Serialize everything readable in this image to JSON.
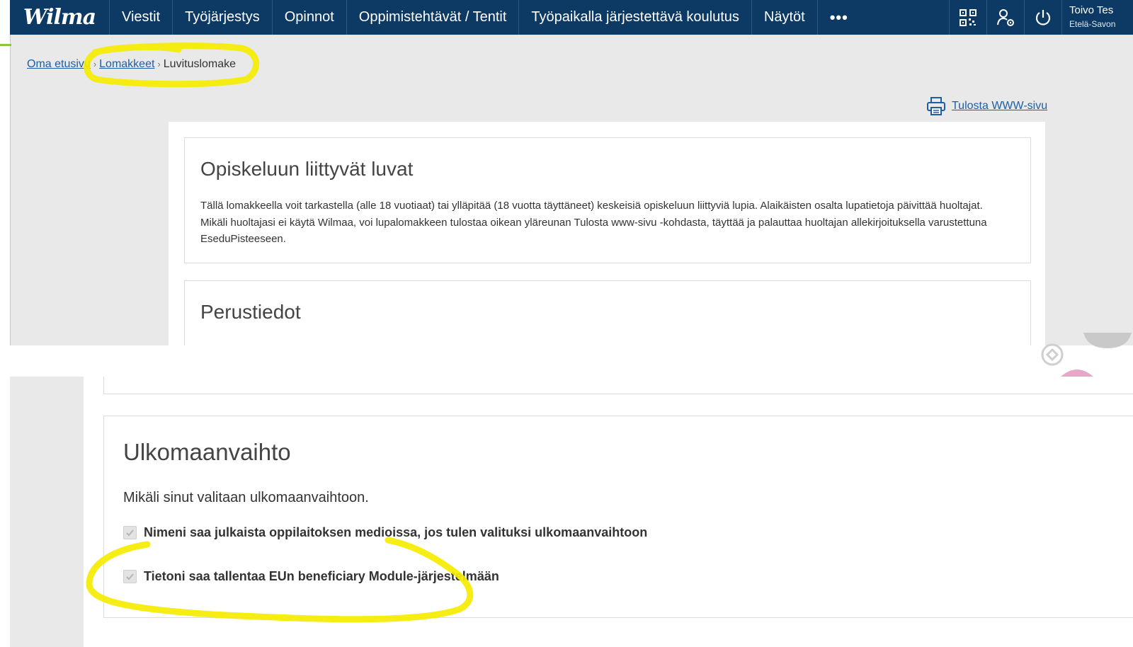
{
  "app": {
    "logo": "Wilma",
    "nav": [
      "Viestit",
      "Työjärjestys",
      "Opinnot",
      "Oppimistehtävät / Tentit",
      "Työpaikalla järjestettävä koulutus",
      "Näytöt"
    ],
    "more": "•••",
    "user": {
      "name": "Toivo Tes",
      "org": "Etelä-Savon"
    }
  },
  "breadcrumb": {
    "home": "Oma etusivu",
    "forms": "Lomakkeet",
    "current": "Luvituslomake"
  },
  "print": {
    "label": "Tulosta WWW-sivu",
    "icon": "printer-icon"
  },
  "intro": {
    "title": "Opiskeluun liittyvät luvat",
    "text": "Tällä lomakkeella voit tarkastella (alle 18 vuotiaat) tai ylläpitää (18 vuotta täyttäneet) keskeisiä opiskeluun liittyviä lupia. Alaikäisten osalta lupatietoja päivittää huoltajat. Mikäli huoltajasi ei käytä Wilmaa, voi lupalomakkeen tulostaa oikean yläreunan Tulosta www-sivu -kohdasta, täyttää ja palauttaa huoltajan allekirjoituksella varustettuna EseduPisteeseen."
  },
  "basic": {
    "title": "Perustiedot"
  },
  "exchange": {
    "title": "Ulkomaanvaihto",
    "description": "Mikäli sinut valitaan ulkomaanvaihtoon.",
    "options": [
      {
        "label": "Nimeni saa julkaista oppilaitoksen medioissa, jos tulen valituksi ulkomaanvaihtoon",
        "checked": true
      },
      {
        "label": "Tietoni saa tallentaa EUn beneficiary Module-järjestelmään",
        "checked": true
      }
    ]
  },
  "colors": {
    "nav": "#0c3a64",
    "link": "#1c5fa8",
    "highlight": "#f5ec00",
    "background": "#e9e9e9"
  }
}
